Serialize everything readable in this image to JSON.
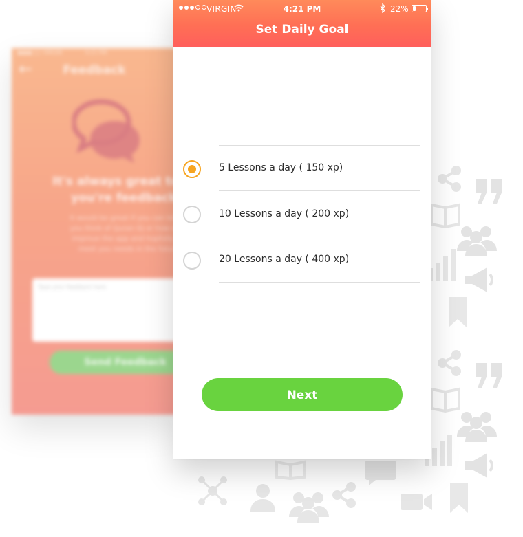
{
  "status_bar": {
    "carrier": "VIRGIN",
    "time": "4:21 PM",
    "battery": "22%"
  },
  "header": {
    "title": "Set Daily Goal"
  },
  "goal_options": [
    {
      "label": "5 Lessons a day ( 150 xp)",
      "selected": true
    },
    {
      "label": "10 Lessons a day ( 200 xp)",
      "selected": false
    },
    {
      "label": "20 Lessons a day ( 400 xp)",
      "selected": false
    }
  ],
  "next_button": {
    "label": "Next"
  },
  "colors": {
    "accent_radio": "#f7a521",
    "button_green": "#69d33f",
    "header_gradient_top": "#ff8a5a",
    "header_gradient_bottom": "#ff5f5c"
  },
  "background_screen": {
    "title": "Feedback",
    "heading_lines": [
      "It's always great to he",
      "you're feedback."
    ],
    "body_lines": [
      "It would be great if you can tell us",
      "you think of Quran IQ or how we c",
      "improve the app and hopfully we",
      "meet you needs in the future"
    ],
    "textarea_placeholder": "Type your feedback here",
    "send_button": "Send Feedback"
  },
  "decorative_icons": [
    "share-icon",
    "quote-icon",
    "book-icon",
    "group-icon",
    "bar-chart-icon",
    "megaphone-icon",
    "bookmark-icon",
    "chat-bubble-icon",
    "molecule-icon",
    "video-icon",
    "person-icon"
  ]
}
